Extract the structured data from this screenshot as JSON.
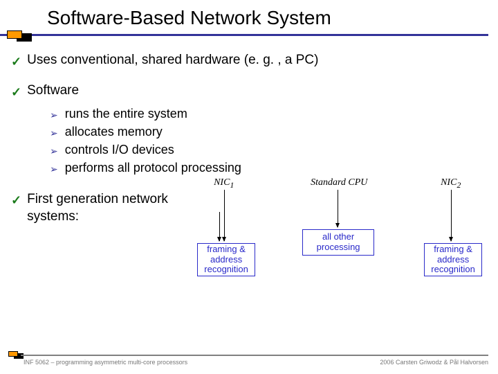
{
  "title": "Software-Based Network System",
  "bullets": {
    "b1": "Uses conventional, shared hardware (e. g. , a PC)",
    "b2": "Software",
    "sub": {
      "s1": "runs the entire system",
      "s2": "allocates memory",
      "s3": "controls I/O devices",
      "s4": "performs all protocol processing"
    },
    "b3": "First generation network systems:"
  },
  "diagram": {
    "nic1": "NIC",
    "nic1_sub": "1",
    "cpu": "Standard CPU",
    "nic2": "NIC",
    "nic2_sub": "2",
    "box_left": "framing & address recognition",
    "box_mid": "all other processing",
    "box_right": "framing & address recognition"
  },
  "footer": {
    "left": "INF 5062 – programming asymmetric multi-core processors",
    "right": "2006  Carsten Griwodz & Pål Halvorsen"
  }
}
